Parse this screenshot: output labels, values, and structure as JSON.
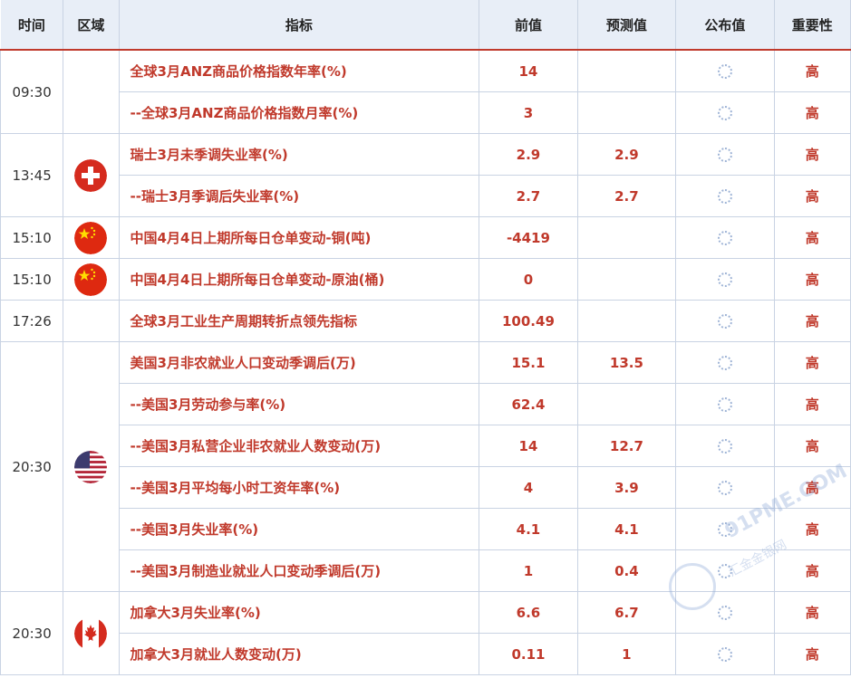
{
  "headers": {
    "time": "时间",
    "region": "区域",
    "indicator": "指标",
    "previous": "前值",
    "forecast": "预测值",
    "actual": "公布值",
    "importance": "重要性"
  },
  "groups": [
    {
      "time": "09:30",
      "flag": "",
      "rows": [
        {
          "name": "全球3月ANZ商品价格指数年率(%)",
          "prev": "14",
          "forecast": "",
          "importance": "高"
        },
        {
          "name": "--全球3月ANZ商品价格指数月率(%)",
          "prev": "3",
          "forecast": "",
          "importance": "高"
        }
      ]
    },
    {
      "time": "13:45",
      "flag": "switzerland-flag-icon",
      "rows": [
        {
          "name": "瑞士3月未季调失业率(%)",
          "prev": "2.9",
          "forecast": "2.9",
          "importance": "高"
        },
        {
          "name": "--瑞士3月季调后失业率(%)",
          "prev": "2.7",
          "forecast": "2.7",
          "importance": "高"
        }
      ]
    },
    {
      "time": "15:10",
      "flag": "china-flag-icon",
      "rows": [
        {
          "name": "中国4月4日上期所每日仓单变动-铜(吨)",
          "prev": "-4419",
          "forecast": "",
          "importance": "高"
        }
      ]
    },
    {
      "time": "15:10",
      "flag": "china-flag-icon",
      "rows": [
        {
          "name": "中国4月4日上期所每日仓单变动-原油(桶)",
          "prev": "0",
          "forecast": "",
          "importance": "高"
        }
      ]
    },
    {
      "time": "17:26",
      "flag": "",
      "rows": [
        {
          "name": "全球3月工业生产周期转折点领先指标",
          "prev": "100.49",
          "forecast": "",
          "importance": "高"
        }
      ]
    },
    {
      "time": "20:30",
      "flag": "usa-flag-icon",
      "rows": [
        {
          "name": "美国3月非农就业人口变动季调后(万)",
          "prev": "15.1",
          "forecast": "13.5",
          "importance": "高"
        },
        {
          "name": "--美国3月劳动参与率(%)",
          "prev": "62.4",
          "forecast": "",
          "importance": "高"
        },
        {
          "name": "--美国3月私营企业非农就业人数变动(万)",
          "prev": "14",
          "forecast": "12.7",
          "importance": "高"
        },
        {
          "name": "--美国3月平均每小时工资年率(%)",
          "prev": "4",
          "forecast": "3.9",
          "importance": "高"
        },
        {
          "name": "--美国3月失业率(%)",
          "prev": "4.1",
          "forecast": "4.1",
          "importance": "高"
        },
        {
          "name": "--美国3月制造业就业人口变动季调后(万)",
          "prev": "1",
          "forecast": "0.4",
          "importance": "高"
        }
      ]
    },
    {
      "time": "20:30",
      "flag": "canada-flag-icon",
      "rows": [
        {
          "name": "加拿大3月失业率(%)",
          "prev": "6.6",
          "forecast": "6.7",
          "importance": "高"
        },
        {
          "name": "加拿大3月就业人数变动(万)",
          "prev": "0.11",
          "forecast": "1",
          "importance": "高"
        }
      ]
    }
  ],
  "watermark": {
    "brand": "91PME.COM",
    "sub": "汇金金银网"
  },
  "colors": {
    "accent_red": "#c0392b",
    "header_bg": "#e8eef7",
    "border": "#c9d3e3"
  }
}
